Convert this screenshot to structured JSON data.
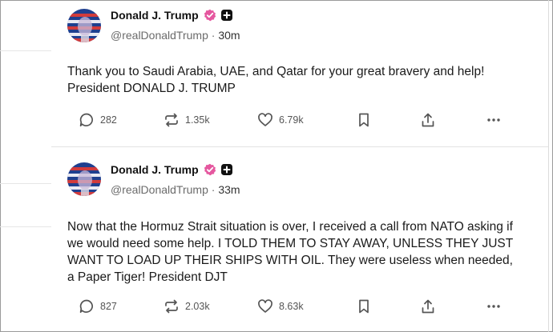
{
  "posts": [
    {
      "author": "Donald J. Trump",
      "handle": "@realDonaldTrump",
      "separator": "·",
      "age": "30m",
      "text": "Thank you to Saudi Arabia, UAE, and Qatar for your great bravery and help! President DONALD J. TRUMP",
      "replies": "282",
      "reposts": "1.35k",
      "likes": "6.79k"
    },
    {
      "author": "Donald J. Trump",
      "handle": "@realDonaldTrump",
      "separator": "·",
      "age": "33m",
      "text": "Now that the Hormuz Strait situation is over, I received a call from NATO asking if we would need some help. I  TOLD THEM TO STAY AWAY, UNLESS THEY JUST WANT TO LOAD UP THEIR SHIPS WITH OIL. They were useless when needed, a Paper Tiger! President DJT",
      "replies": "827",
      "reposts": "2.03k",
      "likes": "8.63k"
    }
  ],
  "colors": {
    "verified_badge": "#e5579f",
    "text": "#1a1a1a",
    "muted": "#6b6b6b"
  },
  "icons": [
    "avatar",
    "verified-badge-icon",
    "plus-badge-icon",
    "reply-icon",
    "repost-icon",
    "like-icon",
    "bookmark-icon",
    "share-icon",
    "more-icon"
  ]
}
